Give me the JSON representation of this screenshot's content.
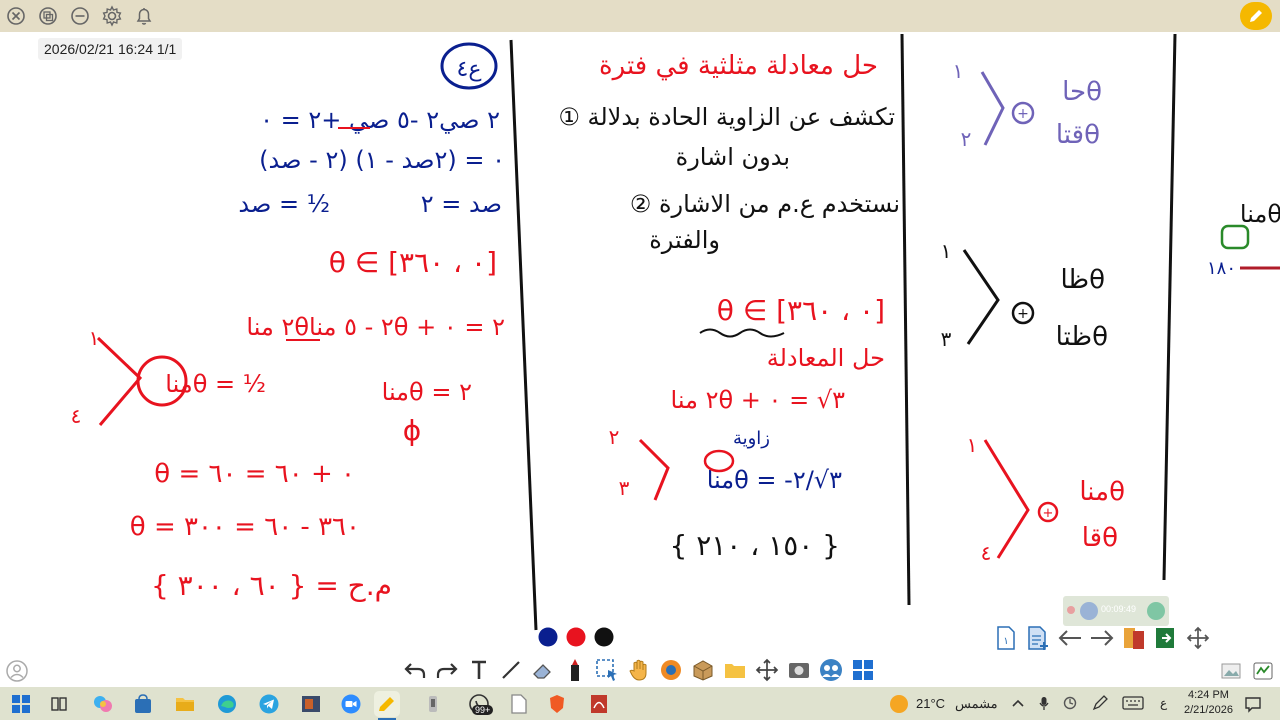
{
  "app": {
    "window_controls": [
      "close-icon",
      "restore-icon",
      "minimize-icon",
      "settings-icon",
      "bell-icon"
    ],
    "pen_icon": "pen-icon"
  },
  "board": {
    "timestamp": "2026/02/21  16:24  1/1",
    "ink_palette": [
      "#0a1f8f",
      "#e8131f",
      "#111111"
    ],
    "col1": {
      "circled_label": "ع٤",
      "eq1": "٢ صي٢ -٥ صي +٢ = ٠",
      "eq2": "(٢ - صد) (٢صد - ١) = ٠",
      "eq3a": "صد = ٢",
      "eq3b": "صد = ½",
      "interval1": "θ ∈ [٠ ، ٣٦٠]",
      "eq4": "٢ مناθ٢ - ٥ مناθ + ٢ = ٠",
      "eq5a": "مناθ = ٢",
      "eq5b": "مناθ = ½",
      "phi": "ɸ",
      "range_top": "١",
      "range_bottom": "٤",
      "eq6": "θ = ٠ + ٦٠ = ٦٠",
      "eq7": "θ = ٣٦٠ - ٦٠ = ٣٠٠",
      "solution": "م.ح = { ٦٠ ، ٣٠٠ }"
    },
    "col2": {
      "heading": "حل معادلة مثلثية في فترة",
      "point1_line1": "① تكشف عن الزاوية الحادة بدلالة",
      "point1_line2": "بدون اشارة",
      "point2_line1": "② نستخدم ع.م من الاشارة",
      "point2_line2": "والفترة",
      "interval2": "θ ∈ [٠ ، ٣٦٠]",
      "sub_heading": "حل المعادلة",
      "eq1": "٢ مناθ + ٣√ = ٠",
      "ratio_note": "زاوية",
      "eq2": "مناθ = -٣√/٢",
      "range_top": "٢",
      "range_bottom": "٣",
      "solution": "{ ١٥٠ ، ٢١٠ }"
    },
    "col3": {
      "blue_top": "حاθ",
      "blue_bottom": "قتاθ",
      "blue_q_top": "١",
      "blue_q_bottom": "٢",
      "black_top": "ظاθ",
      "black_bottom": "ظتاθ",
      "black_q_top": "١",
      "black_q_bottom": "٣",
      "red_top": "مناθ",
      "red_bottom": "قاθ",
      "red_q_top": "١",
      "red_q_bottom": "٤"
    },
    "col4": {
      "partial_text": "مناθ",
      "partial_label": "١٨٠"
    }
  },
  "recording": {
    "time": "00:09:49"
  },
  "toolbar": {
    "tools": [
      "undo-icon",
      "redo-icon",
      "text-icon",
      "line-icon",
      "eraser-icon",
      "marker-icon",
      "select-icon",
      "hand-icon",
      "browser-icon",
      "box-icon",
      "folder-icon",
      "move-icon",
      "camera-icon",
      "people-icon",
      "windows-icon"
    ]
  },
  "page_nav": {
    "page_number": "١"
  },
  "taskbar": {
    "notification_badge": "99+",
    "weather_temp": "21°C",
    "weather_label": "مشمس",
    "lang": "ع",
    "time": "4:24 PM",
    "date": "2/21/2026"
  }
}
